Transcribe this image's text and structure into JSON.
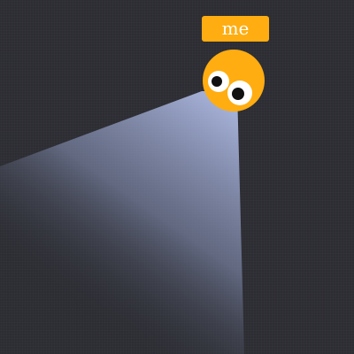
{
  "player": {
    "name": "me",
    "body_color": "#ffad10",
    "tag_color": "#ffad10"
  },
  "scene": {
    "background_color": "#2c2d33",
    "light_color": "#b7c3ee"
  },
  "icons": {
    "player": "smiley-face-icon",
    "light": "flashlight-beam"
  }
}
